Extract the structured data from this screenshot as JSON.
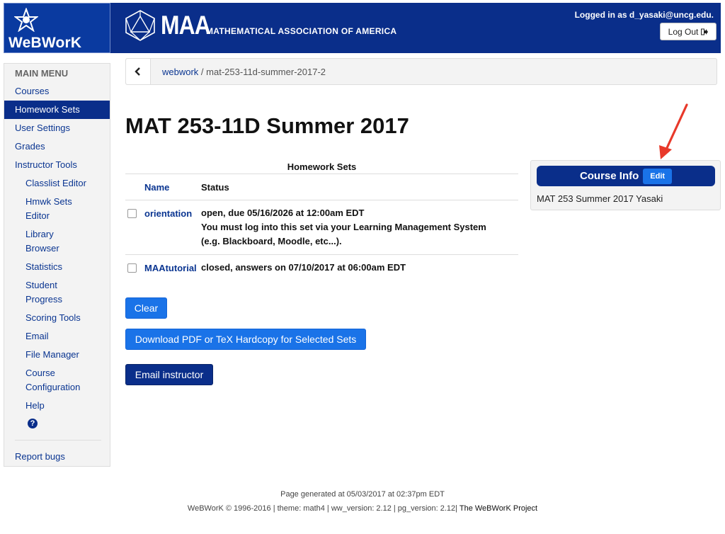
{
  "header": {
    "brand": "WeBWorK",
    "maa": "MAA",
    "maa_full": "MATHEMATICAL ASSOCIATION OF AMERICA",
    "login_text": "Logged in as d_yasaki@uncg.edu.",
    "logout_label": "Log Out",
    "logout_icon": "sign-out-icon"
  },
  "sidebar": {
    "title": "MAIN MENU",
    "items": [
      {
        "label": "Courses"
      },
      {
        "label": "Homework Sets",
        "active": true
      },
      {
        "label": "User Settings"
      },
      {
        "label": "Grades"
      },
      {
        "label": "Instructor Tools"
      },
      {
        "label": "Classlist Editor"
      },
      {
        "label": "Hmwk Sets"
      },
      {
        "label": "Editor"
      },
      {
        "label": "Library"
      },
      {
        "label": "Browser"
      },
      {
        "label": "Statistics"
      },
      {
        "label": "Student"
      },
      {
        "label": "Progress"
      },
      {
        "label": "Scoring Tools"
      },
      {
        "label": "Email"
      },
      {
        "label": "File Manager"
      },
      {
        "label": "Course"
      },
      {
        "label": "Configuration"
      },
      {
        "label": "Help"
      }
    ],
    "help_icon": "?",
    "report_bugs": "Report bugs"
  },
  "breadcrumb": {
    "root": "webwork",
    "separator": "/",
    "current": "mat-253-11d-summer-2017-2"
  },
  "main": {
    "title": "MAT 253-11D Summer 2017",
    "table_caption": "Homework Sets",
    "col_name": "Name",
    "col_status": "Status",
    "rows": [
      {
        "name": "orientation",
        "status_line1": "open, due 05/16/2026 at 12:00am EDT",
        "status_line2": "You must log into this set via your Learning Management System",
        "status_line3": "(e.g. Blackboard, Moodle, etc...)."
      },
      {
        "name": "MAAtutorial",
        "status_line1": "closed, answers on 07/10/2017 at 06:00am EDT"
      }
    ],
    "clear_label": "Clear",
    "download_label": "Download PDF or TeX Hardcopy for Selected Sets",
    "email_label": "Email instructor"
  },
  "course_info": {
    "title": "Course Info",
    "edit_label": "Edit",
    "body": "MAT 253 Summer 2017 Yasaki"
  },
  "footer": {
    "generated": "Page generated at 05/03/2017 at 02:37pm EDT",
    "copyright": "WeBWorK © 1996-2016 | theme: math4 | ww_version: 2.12 | pg_version: 2.12|",
    "project": "The WeBWorK Project"
  },
  "colors": {
    "navy": "#0a2e8a",
    "link": "#0a3591",
    "button_blue": "#1a73e8",
    "annotation_arrow": "#e8392a"
  }
}
